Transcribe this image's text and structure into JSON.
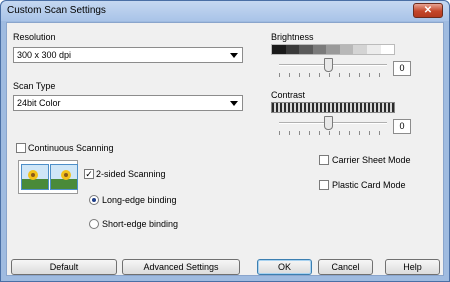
{
  "window": {
    "title": "Custom Scan Settings",
    "close_glyph": "✕"
  },
  "resolution": {
    "label": "Resolution",
    "value": "300 x 300 dpi"
  },
  "scan_type": {
    "label": "Scan Type",
    "value": "24bit Color"
  },
  "brightness": {
    "label": "Brightness",
    "value": "0",
    "level": 0.5
  },
  "contrast": {
    "label": "Contrast",
    "value": "0",
    "level": 0.5
  },
  "options": {
    "continuous_scanning": {
      "label": "Continuous Scanning",
      "checked": false
    },
    "two_sided": {
      "label": "2-sided Scanning",
      "checked": true,
      "check_glyph": "✓"
    },
    "long_edge": {
      "label": "Long-edge binding",
      "selected": true
    },
    "short_edge": {
      "label": "Short-edge binding",
      "selected": false
    },
    "carrier_sheet": {
      "label": "Carrier Sheet Mode",
      "checked": false
    },
    "plastic_card": {
      "label": "Plastic Card Mode",
      "checked": false
    }
  },
  "buttons": {
    "default": "Default",
    "advanced": "Advanced Settings",
    "ok": "OK",
    "cancel": "Cancel",
    "help": "Help"
  },
  "icons": {
    "close": "close-icon",
    "dropdown": "chevron-down-icon",
    "duplex": "duplex-page-icon"
  }
}
